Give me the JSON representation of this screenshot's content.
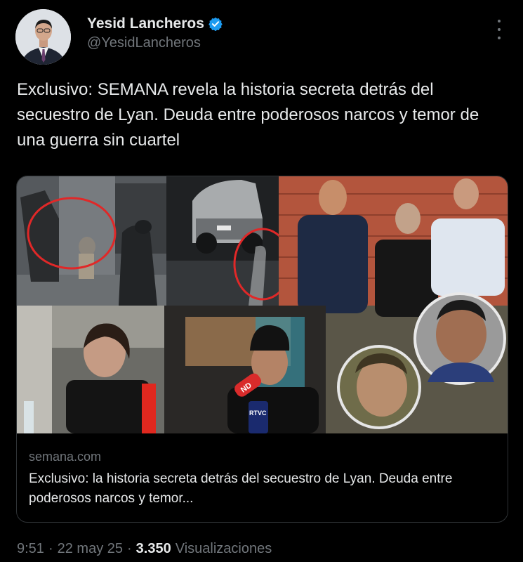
{
  "author": {
    "name": "Yesid Lancheros",
    "handle": "@YesidLancheros",
    "verified": true,
    "avatar_icon": "profile-avatar"
  },
  "tweet": {
    "text": "Exclusivo: SEMANA revela la historia secreta detrás del secuestro de Lyan. Deuda entre poderosos narcos y temor de una guerra sin cuartel"
  },
  "card": {
    "domain": "semana.com",
    "title": "Exclusivo: la historia secreta detrás del secuestro de Lyan. Deuda entre poderosos narcos y temor...",
    "image_overlay": {
      "mic_label_1": "ND",
      "mic_label_2": "RTVC"
    }
  },
  "meta": {
    "time": "9:51",
    "sep1": "·",
    "date": "22 may 25",
    "sep2": "·",
    "views_count": "3.350",
    "views_label": "Visualizaciones"
  },
  "colors": {
    "background": "#000000",
    "text": "#e7e9ea",
    "secondary": "#71767b",
    "verified": "#1d9bf0",
    "border": "#2f3336"
  }
}
